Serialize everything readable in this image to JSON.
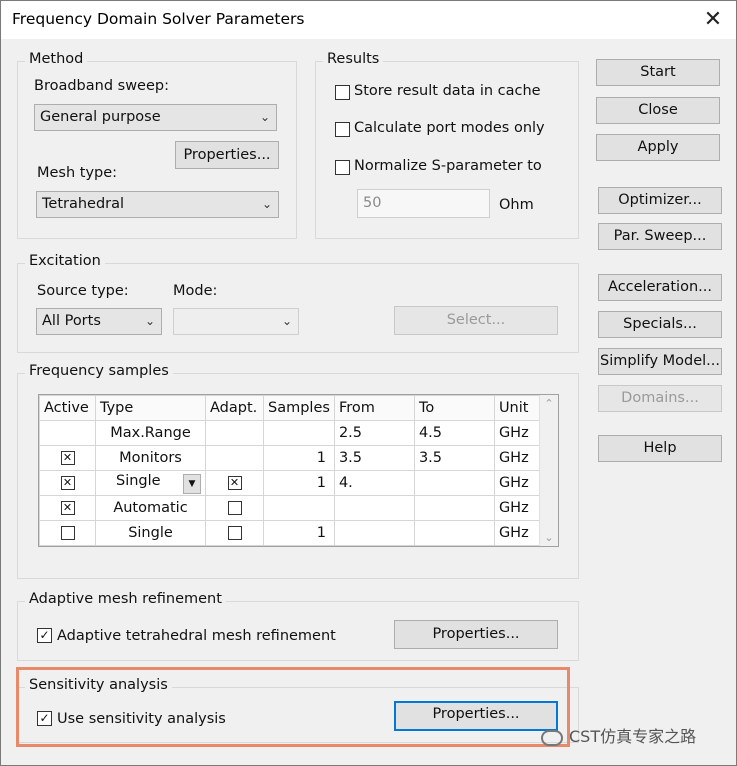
{
  "window": {
    "title": "Frequency Domain Solver Parameters",
    "close_glyph": "✕"
  },
  "method": {
    "group_label": "Method",
    "broadband_label": "Broadband sweep:",
    "broadband_value": "General purpose",
    "properties_label": "Properties...",
    "mesh_label": "Mesh type:",
    "mesh_value": "Tetrahedral"
  },
  "results": {
    "group_label": "Results",
    "store_label": "Store result data in cache",
    "store_checked": false,
    "port_modes_label": "Calculate port modes only",
    "port_modes_checked": false,
    "normalize_label": "Normalize S-parameter to",
    "normalize_checked": false,
    "normalize_value": "50",
    "ohm_label": "Ohm"
  },
  "excitation": {
    "group_label": "Excitation",
    "source_label": "Source type:",
    "mode_label": "Mode:",
    "source_value": "All Ports",
    "mode_value": "",
    "select_label": "Select..."
  },
  "samples": {
    "group_label": "Frequency samples",
    "columns": [
      "Active",
      "Type",
      "Adapt.",
      "Samples",
      "From",
      "To",
      "Unit"
    ],
    "rows": [
      {
        "active": "",
        "type": "Max.Range",
        "adapt": "",
        "samples": "",
        "from": "2.5",
        "to": "4.5",
        "unit": "GHz"
      },
      {
        "active": "☒",
        "type": "Monitors",
        "adapt": "",
        "samples": "1",
        "from": "3.5",
        "to": "3.5",
        "unit": "GHz"
      },
      {
        "active": "☒",
        "type": "Single",
        "adapt": "☒",
        "samples": "1",
        "from": "4.",
        "to": "",
        "unit": "GHz"
      },
      {
        "active": "☒",
        "type": "Automatic",
        "adapt": "☐",
        "samples": "",
        "from": "",
        "to": "",
        "unit": "GHz"
      },
      {
        "active": "☐",
        "type": "Single",
        "adapt": "☐",
        "samples": "1",
        "from": "",
        "to": "",
        "unit": "GHz"
      }
    ]
  },
  "adaptive": {
    "group_label": "Adaptive mesh refinement",
    "check_label": "Adaptive tetrahedral mesh refinement",
    "checked": true,
    "properties_label": "Properties..."
  },
  "sensitivity": {
    "group_label": "Sensitivity analysis",
    "check_label": "Use sensitivity analysis",
    "checked": true,
    "properties_label": "Properties..."
  },
  "side_buttons": {
    "start": "Start",
    "close": "Close",
    "apply": "Apply",
    "optimizer": "Optimizer...",
    "par_sweep": "Par. Sweep...",
    "acceleration": "Acceleration...",
    "specials": "Specials...",
    "simplify": "Simplify Model...",
    "domains": "Domains...",
    "help": "Help"
  },
  "watermark": {
    "text": "CST仿真专家之路"
  },
  "colors": {
    "highlight": "#e8896a",
    "focus": "#0078d7"
  }
}
